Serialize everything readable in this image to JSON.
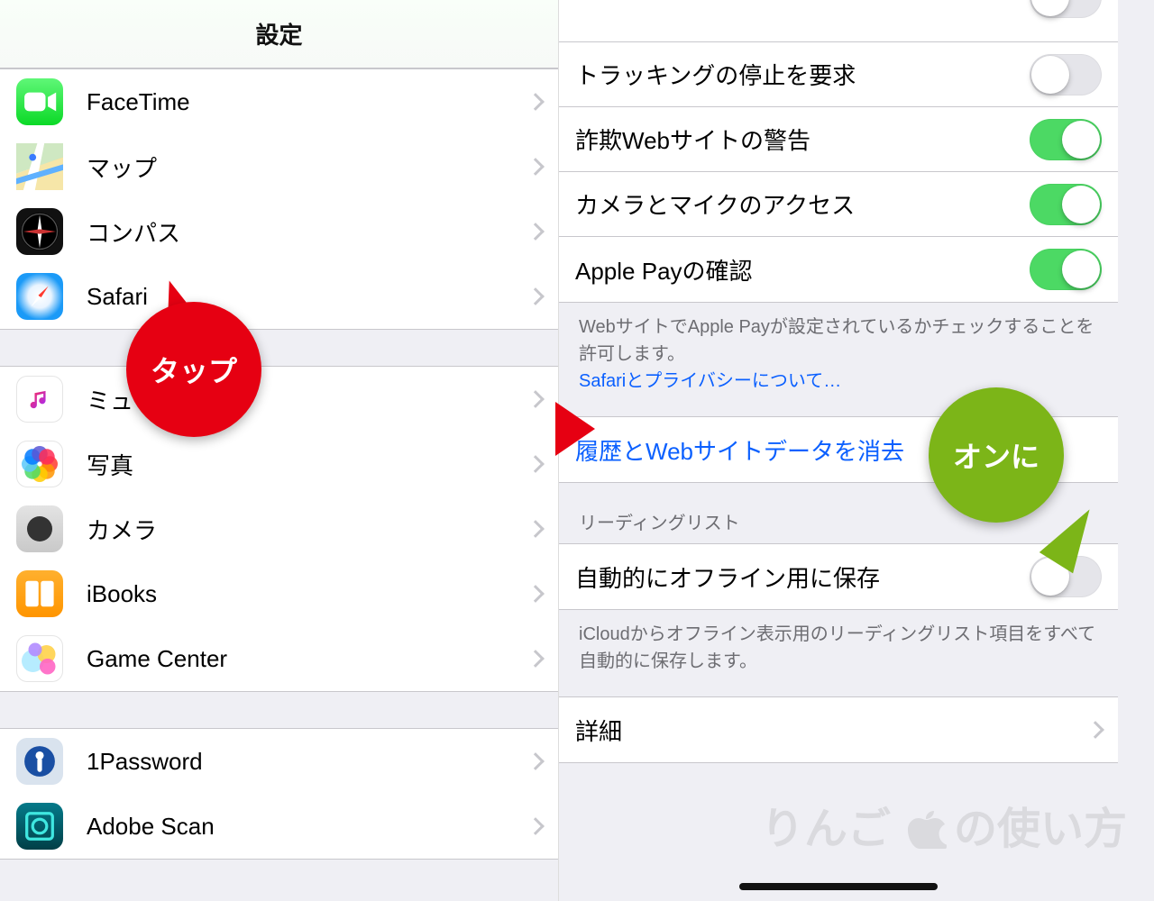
{
  "left": {
    "title": "設定",
    "groups": [
      {
        "items": [
          {
            "icon": "facetime",
            "label": "FaceTime",
            "name": "row-facetime"
          },
          {
            "icon": "maps",
            "label": "マップ",
            "name": "row-maps"
          },
          {
            "icon": "compass",
            "label": "コンパス",
            "name": "row-compass"
          },
          {
            "icon": "safari",
            "label": "Safari",
            "name": "row-safari"
          }
        ]
      },
      {
        "items": [
          {
            "icon": "music",
            "label": "ミュージック",
            "name": "row-music"
          },
          {
            "icon": "photos",
            "label": "写真",
            "name": "row-photos"
          },
          {
            "icon": "camera",
            "label": "カメラ",
            "name": "row-camera"
          },
          {
            "icon": "ibooks",
            "label": "iBooks",
            "name": "row-ibooks"
          },
          {
            "icon": "gamecenter",
            "label": "Game Center",
            "name": "row-gamecenter"
          }
        ]
      },
      {
        "items": [
          {
            "icon": "1password",
            "label": "1Password",
            "name": "row-1password"
          },
          {
            "icon": "adobescan",
            "label": "Adobe Scan",
            "name": "row-adobescan"
          }
        ]
      }
    ]
  },
  "right": {
    "privacy_rows": [
      {
        "label": "トラッキングの停止を要求",
        "on": false,
        "name": "toggle-do-not-track"
      },
      {
        "label": "詐欺Webサイトの警告",
        "on": true,
        "name": "toggle-fraud-warning"
      },
      {
        "label": "カメラとマイクのアクセス",
        "on": true,
        "name": "toggle-camera-mic"
      },
      {
        "label": "Apple Payの確認",
        "on": true,
        "name": "toggle-apple-pay"
      }
    ],
    "privacy_footer_text": "WebサイトでApple Payが設定されているかチェックすることを許可します。",
    "privacy_footer_link": "Safariとプライバシーについて…",
    "clear_history_label": "履歴とWebサイトデータを消去",
    "reading_list_header": "リーディングリスト",
    "reading_list_row": {
      "label": "自動的にオフライン用に保存",
      "on": false,
      "name": "toggle-reading-list-offline"
    },
    "reading_list_footer": "iCloudからオフライン表示用のリーディングリスト項目をすべて自動的に保存します。",
    "advanced_label": "詳細"
  },
  "callouts": {
    "tap": "タップ",
    "on": "オンに"
  },
  "watermark": "りんご　の使い方",
  "icon_glyphs": {
    "facetime": "■",
    "maps": "✈︎",
    "compass": "✦",
    "ibooks": "▯▯",
    "1password": "◉",
    "adobescan": "▣"
  }
}
